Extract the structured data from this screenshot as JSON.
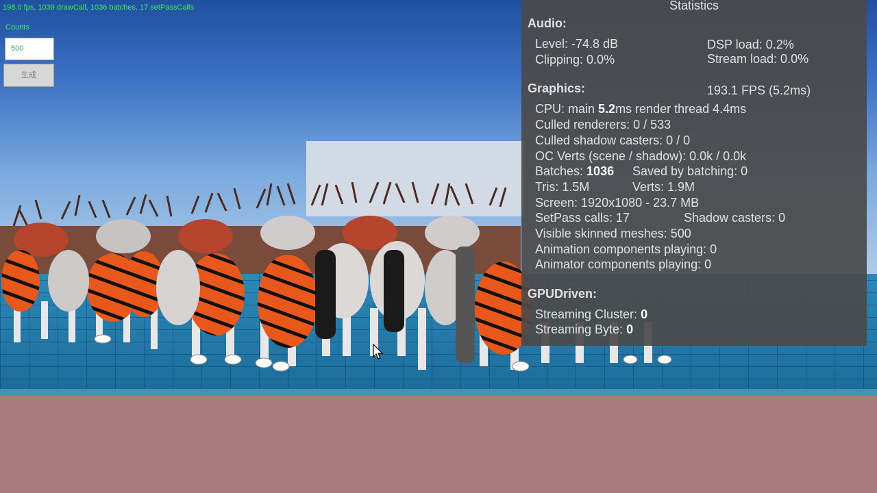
{
  "hud": {
    "stats_line": "198.0 fps, 1039 drawCall, 1036 batches, 17 setPassCalls",
    "count_label": "Counts",
    "count_value": "500",
    "apply_button": "生成"
  },
  "statistics": {
    "title": "Statistics",
    "audio": {
      "heading": "Audio:",
      "level": "Level: -74.8 dB",
      "dsp_load": "DSP load: 0.2%",
      "clipping": "Clipping: 0.0%",
      "stream_load": "Stream load: 0.0%"
    },
    "graphics": {
      "heading": "Graphics:",
      "fps": "193.1 FPS (5.2ms)",
      "cpu_prefix": "CPU: main ",
      "cpu_main": "5.2",
      "cpu_suffix": "ms  render thread 4.4ms",
      "culled_renderers": "Culled renderers: 0 / 533",
      "culled_shadow": "Culled shadow casters: 0 / 0",
      "oc_verts": "OC Verts (scene / shadow): 0.0k / 0.0k",
      "batches_prefix": "Batches: ",
      "batches_value": "1036",
      "saved_by_batching": "Saved by batching: 0",
      "tris": "Tris: 1.5M",
      "verts": "Verts: 1.9M",
      "screen": "Screen: 1920x1080 - 23.7 MB",
      "setpass": "SetPass calls: 17",
      "shadow_casters": "Shadow casters: 0",
      "skinned_meshes": "Visible skinned meshes: 500",
      "animation_components": "Animation components playing: 0",
      "animator_components": "Animator components playing: 0"
    },
    "gpu_driven": {
      "heading": "GPUDriven:",
      "streaming_cluster_label": "Streaming Cluster: ",
      "streaming_cluster_value": "0",
      "streaming_byte_label": "Streaming Byte: ",
      "streaming_byte_value": "0"
    }
  },
  "colors": {
    "hud_text": "#3ef04b",
    "panel_bg": "#4a4a4a",
    "floor": "#2c89b8",
    "ground_plane": "#a87a7c"
  }
}
